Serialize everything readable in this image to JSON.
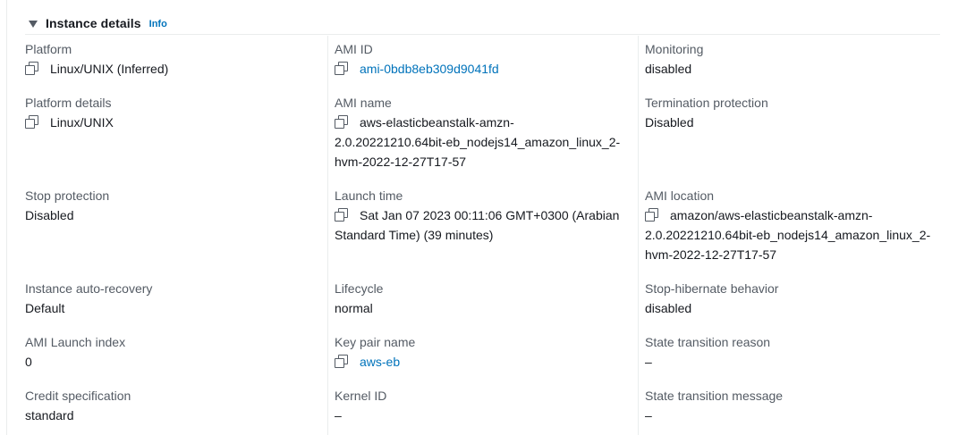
{
  "section": {
    "title": "Instance details",
    "info_link": "Info"
  },
  "fields": {
    "platform": {
      "label": "Platform",
      "value": "Linux/UNIX (Inferred)"
    },
    "ami_id": {
      "label": "AMI ID",
      "value": "ami-0bdb8eb309d9041fd"
    },
    "monitoring": {
      "label": "Monitoring",
      "value": "disabled"
    },
    "platform_details": {
      "label": "Platform details",
      "value": "Linux/UNIX"
    },
    "ami_name": {
      "label": "AMI name",
      "line1": "aws-elasticbeanstalk-amzn-",
      "line2": "2.0.20221210.64bit-eb_nodejs14_amazon_linux_2-",
      "line3": "hvm-2022-12-27T17-57"
    },
    "termination_protection": {
      "label": "Termination protection",
      "value": "Disabled"
    },
    "stop_protection": {
      "label": "Stop protection",
      "value": "Disabled"
    },
    "launch_time": {
      "label": "Launch time",
      "line1": "Sat Jan 07 2023 00:11:06 GMT+0300 (Arabian",
      "line2": "Standard Time) (39 minutes)"
    },
    "ami_location": {
      "label": "AMI location",
      "line1": "amazon/aws-elasticbeanstalk-amzn-",
      "line2": "2.0.20221210.64bit-eb_nodejs14_amazon_linux_2-",
      "line3": "hvm-2022-12-27T17-57"
    },
    "instance_auto_recovery": {
      "label": "Instance auto-recovery",
      "value": "Default"
    },
    "lifecycle": {
      "label": "Lifecycle",
      "value": "normal"
    },
    "stop_hibernate_behavior": {
      "label": "Stop-hibernate behavior",
      "value": "disabled"
    },
    "ami_launch_index": {
      "label": "AMI Launch index",
      "value": "0"
    },
    "key_pair_name": {
      "label": "Key pair name",
      "value": "aws-eb"
    },
    "state_transition_reason": {
      "label": "State transition reason",
      "value": "–"
    },
    "credit_specification": {
      "label": "Credit specification",
      "value": "standard"
    },
    "kernel_id": {
      "label": "Kernel ID",
      "value": "–"
    },
    "state_transition_message": {
      "label": "State transition message",
      "value": "–"
    }
  },
  "colors": {
    "label": "#545b64",
    "value": "#16191f",
    "link": "#0073bb",
    "divider": "#eaeded"
  },
  "icons": {
    "copy": "copy-icon",
    "expand": "caret-down-icon"
  }
}
